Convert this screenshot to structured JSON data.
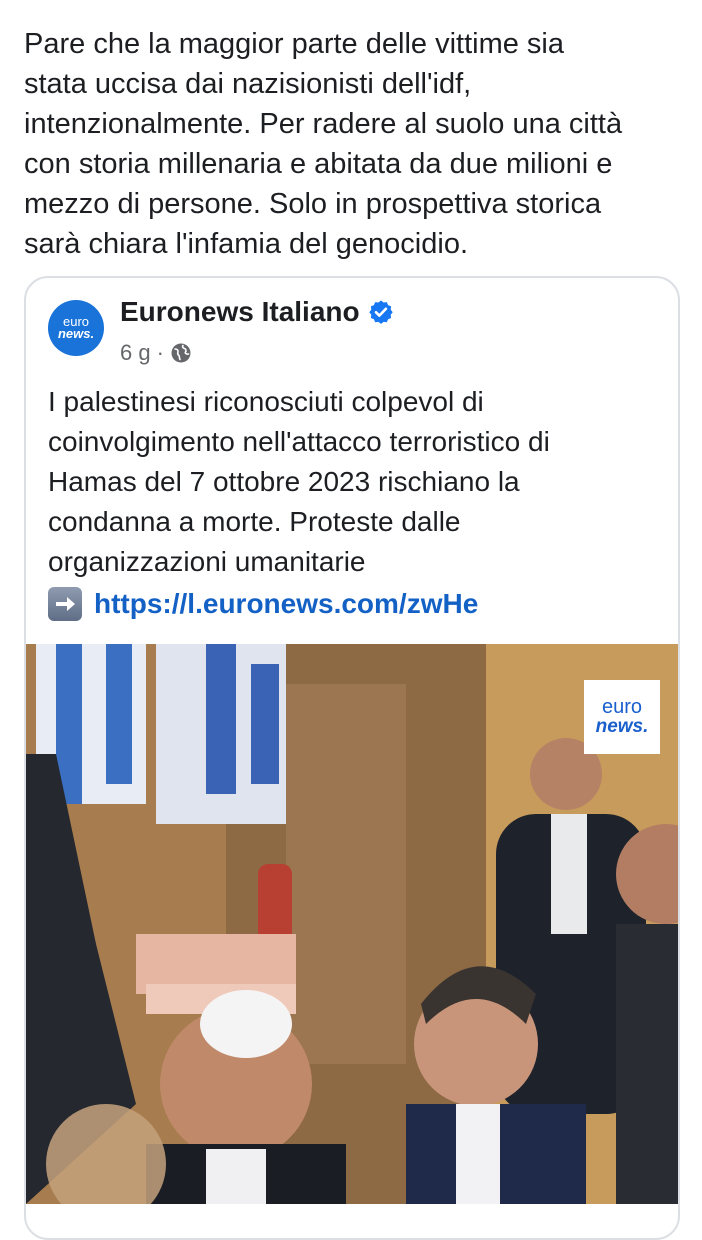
{
  "post": {
    "text": "Pare che la maggior parte delle vittime sia\nstata uccisa dai nazisionisti dell'idf,\nintenzionalmente. Per radere al suolo una città\ncon storia millenaria e abitata da due milioni e\nmezzo di persone. Solo in prospettiva storica\nsarà chiara l'infamia del genocidio."
  },
  "shared": {
    "page_name": "Euronews Italiano",
    "time": "6 g",
    "separator": "·",
    "avatar_line1": "euro",
    "avatar_line2": "news.",
    "text": "I palestinesi riconosciuti colpevol di\ncoinvolgimento nell'attacco terroristico di\nHamas del 7 ottobre 2023 rischiano la\ncondanna a morte. Proteste dalle\norganizzazioni umanitarie",
    "link": "https://l.euronews.com/zwHe",
    "watermark_line1": "euro",
    "watermark_line2": "news."
  },
  "icons": {
    "verified": "verified-badge-icon",
    "audience": "globe-icon",
    "link_arrow": "right-arrow-emoji-icon"
  },
  "colors": {
    "link": "#1461c6",
    "verified": "#1877f2",
    "avatar": "#1a73d9",
    "meta_text": "#65676b"
  }
}
